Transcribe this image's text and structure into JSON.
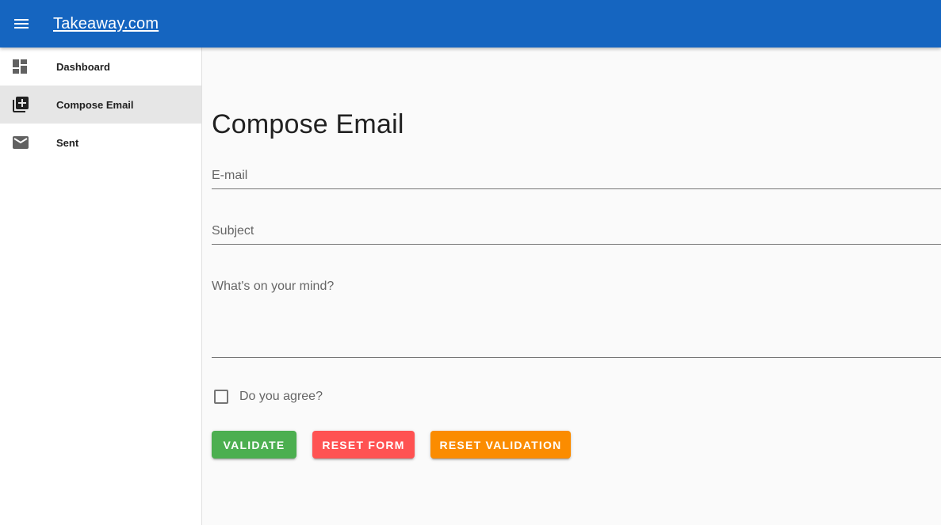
{
  "app": {
    "brand": "Takeaway.com",
    "accent_color": "#1565c0"
  },
  "sidebar": {
    "items": [
      {
        "label": "Dashboard",
        "icon": "dashboard-icon",
        "active": false
      },
      {
        "label": "Compose Email",
        "icon": "library-add-icon",
        "active": true
      },
      {
        "label": "Sent",
        "icon": "mail-icon",
        "active": false
      }
    ]
  },
  "main": {
    "title": "Compose Email",
    "email_label": "E-mail",
    "email_value": "",
    "subject_label": "Subject",
    "subject_value": "",
    "message_label": "What's on your mind?",
    "message_value": "",
    "agree_label": "Do you agree?",
    "agree_checked": false,
    "buttons": {
      "validate": {
        "label": "Validate",
        "color": "#4caf50"
      },
      "reset_form": {
        "label": "Reset Form",
        "color": "#ff5252"
      },
      "reset_validation": {
        "label": "Reset Validation",
        "color": "#fb8c00"
      }
    }
  }
}
